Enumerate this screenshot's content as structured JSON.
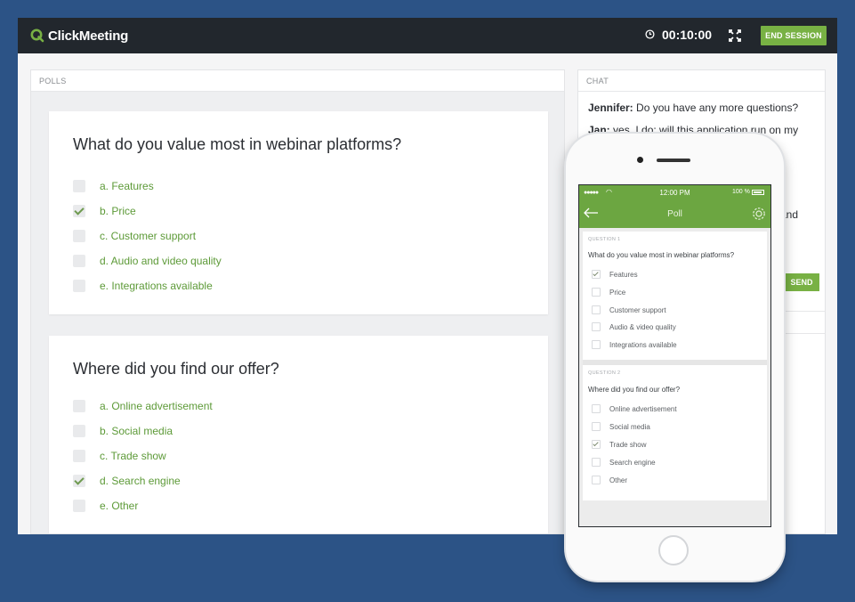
{
  "app": {
    "brand": "ClickMeeting",
    "timer": "00:10:00",
    "end_session_label": "END SESSION"
  },
  "polls": {
    "panel_label": "POLLS",
    "questions": [
      {
        "title": "What do you value most in webinar platforms?",
        "options": [
          {
            "label": "a. Features",
            "checked": false
          },
          {
            "label": "b. Price",
            "checked": true
          },
          {
            "label": "c. Customer support",
            "checked": false
          },
          {
            "label": "d. Audio and video quality",
            "checked": false
          },
          {
            "label": "e. Integrations available",
            "checked": false
          }
        ]
      },
      {
        "title": "Where did you find our offer?",
        "options": [
          {
            "label": "a. Online advertisement",
            "checked": false
          },
          {
            "label": "b. Social media",
            "checked": false
          },
          {
            "label": "c. Trade show",
            "checked": false
          },
          {
            "label": "d. Search engine",
            "checked": true
          },
          {
            "label": "e. Other",
            "checked": false
          }
        ]
      }
    ]
  },
  "chat": {
    "panel_label": "CHAT",
    "messages": [
      {
        "author": "Jennifer:",
        "text": "Do you have any more questions?"
      },
      {
        "author": "Jan:",
        "text": "yes, I do: will this application run on my"
      }
    ],
    "visible_fragment": "and",
    "send_label": "SEND"
  },
  "phone": {
    "status_time": "12:00 PM",
    "status_battery": "100 %",
    "nav_title": "Poll",
    "questions": [
      {
        "label": "QUESTION 1",
        "title": "What do you value most in webinar platforms?",
        "options": [
          {
            "label": "Features",
            "checked": true
          },
          {
            "label": "Price",
            "checked": false
          },
          {
            "label": "Customer support",
            "checked": false
          },
          {
            "label": "Audio & video quality",
            "checked": false
          },
          {
            "label": "Integrations available",
            "checked": false
          }
        ]
      },
      {
        "label": "QUESTION 2",
        "title": "Where did you find our offer?",
        "options": [
          {
            "label": "Online advertisement",
            "checked": false
          },
          {
            "label": "Social media",
            "checked": false
          },
          {
            "label": "Trade show",
            "checked": true
          },
          {
            "label": "Search engine",
            "checked": false
          },
          {
            "label": "Other",
            "checked": false
          }
        ]
      }
    ]
  },
  "colors": {
    "background": "#2c5386",
    "topbar": "#22272d",
    "accent_green": "#78b144",
    "phone_green": "#6ca641"
  }
}
